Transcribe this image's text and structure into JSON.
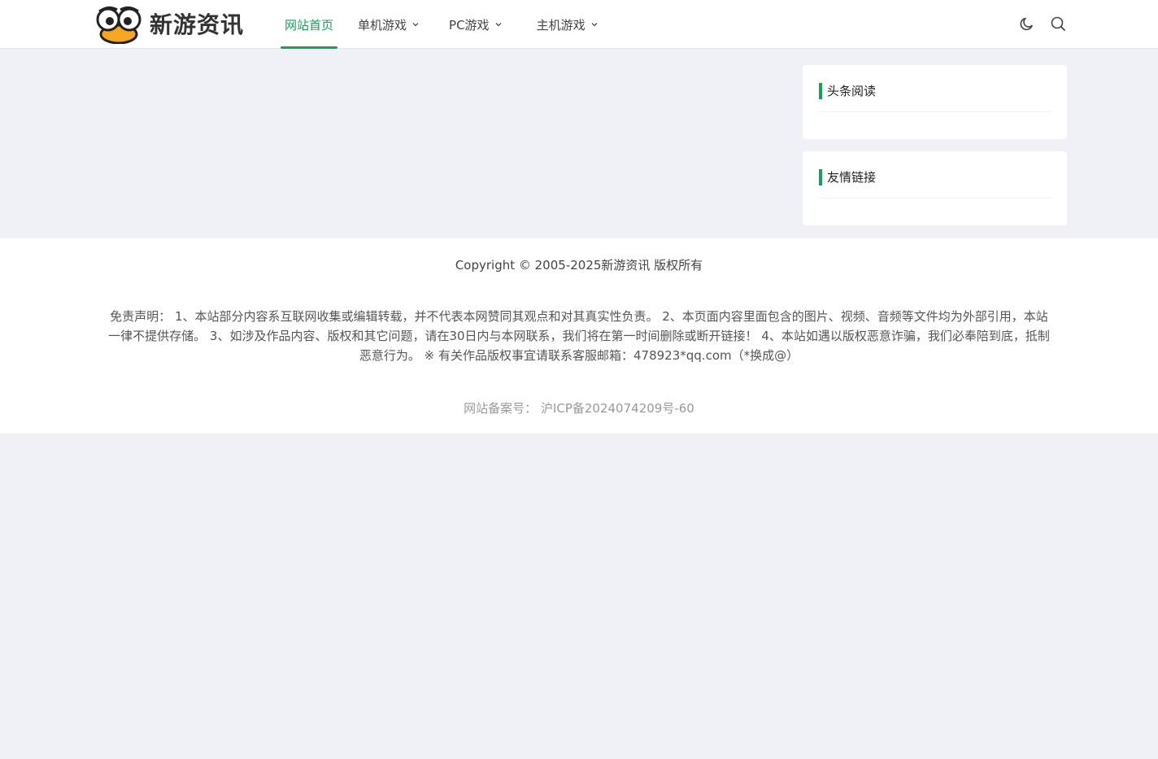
{
  "brand": {
    "name": "新游资讯"
  },
  "nav": {
    "items": [
      {
        "label": "网站首页",
        "active": true,
        "has_dropdown": false
      },
      {
        "label": "单机游戏",
        "active": false,
        "has_dropdown": true
      },
      {
        "label": "PC游戏",
        "active": false,
        "has_dropdown": true
      },
      {
        "label": "主机游戏",
        "active": false,
        "has_dropdown": true
      }
    ]
  },
  "tools": {
    "theme_icon": "moon-icon",
    "search_icon": "search-icon"
  },
  "sidebar": {
    "widgets": [
      {
        "title": "头条阅读"
      },
      {
        "title": "友情链接"
      }
    ]
  },
  "footer": {
    "copyright": "Copyright © 2005-2025新游资讯 版权所有",
    "disclaimer": "免责声明： 1、本站部分内容系互联网收集或编辑转载，并不代表本网赞同其观点和对其真实性负责。 2、本页面内容里面包含的图片、视频、音频等文件均为外部引用，本站一律不提供存储。 3、如涉及作品内容、版权和其它问题，请在30日内与本网联系，我们将在第一时间删除或断开链接！ 4、本站如遇以版权恶意诈骗，我们必奉陪到底，抵制恶意行为。 ※ 有关作品版权事宜请联系客服邮箱：478923*qq.com（*换成@）",
    "icp": "网站备案号： 沪ICP备2024074209号-60"
  },
  "colors": {
    "accent": "#18a058",
    "page_bg": "#f0f1f6"
  }
}
